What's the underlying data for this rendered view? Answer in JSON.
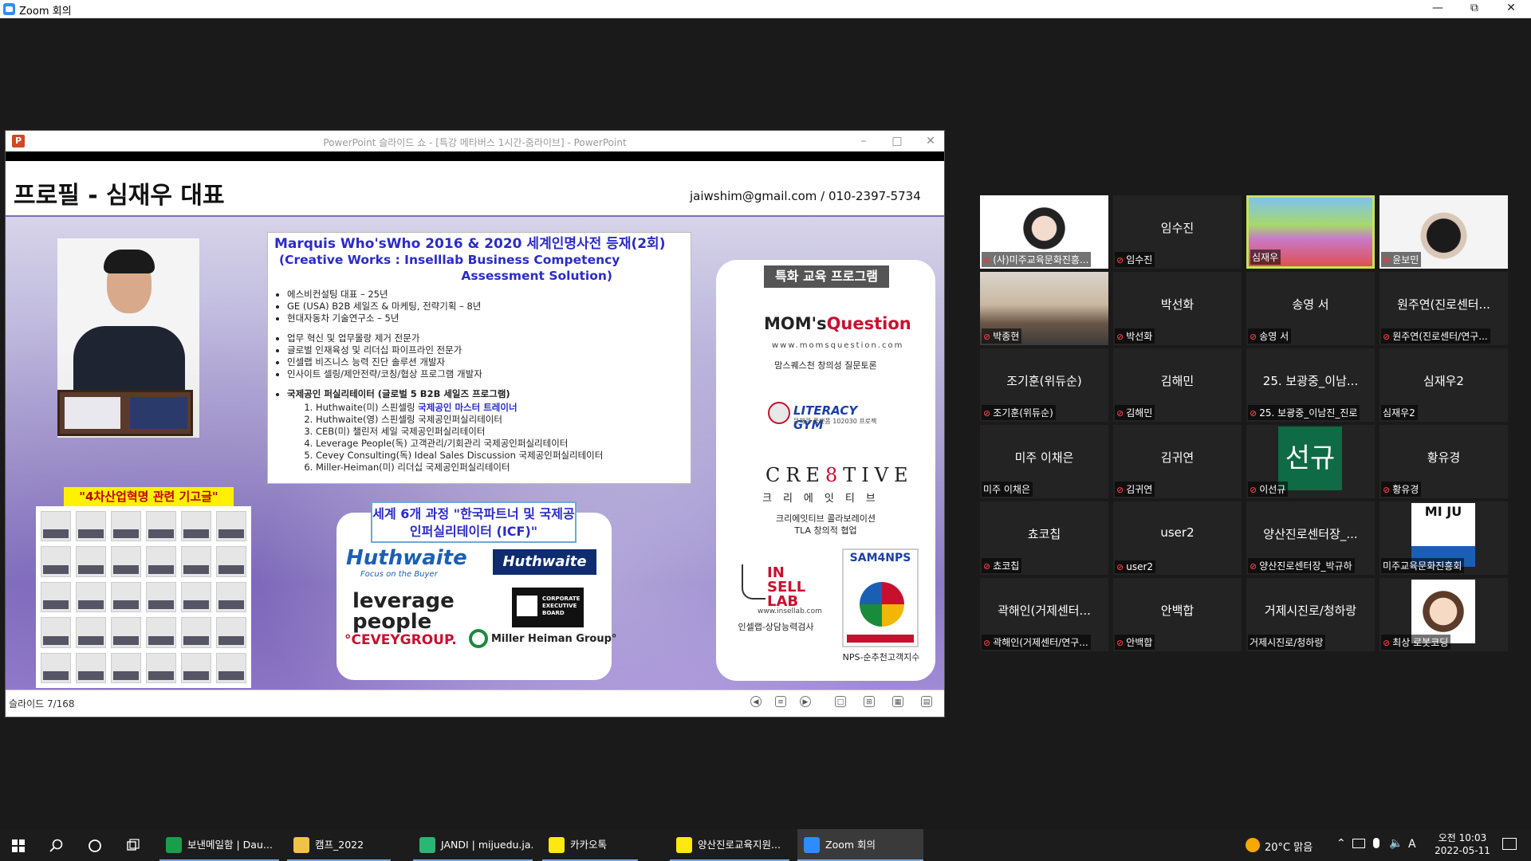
{
  "zoom_window": {
    "title": "Zoom 회의"
  },
  "ppt_window": {
    "title": "PowerPoint 슬라이드 쇼 - [특강 메타버스 1시간-줌라이브] - PowerPoint",
    "status": "슬라이드 7/168"
  },
  "slide": {
    "title": "프로필 - 심재우 대표",
    "contact": "jaiwshim@gmail.com  /  010-2397-5734",
    "main_heading_1": "Marquis Who'sWho 2016 & 2020 세계인명사전 등재(2회)",
    "main_heading_2": "(Creative Works : Inselllab Business Competency",
    "main_heading_3": "Assessment Solution)",
    "career": [
      "에스비컨설팅 대표 – 25년",
      "GE (USA) B2B 세일즈 & 마케팅, 전략기획 – 8년",
      "현대자동차 기술연구소 – 5년"
    ],
    "expertise": [
      "업무 혁신 및 업무몰랑 제거 전문가",
      "글로벌 인재육성 및 리더십 파이프라인 전문가",
      "인셀랩 비즈니스 능력 진단 솔루션 개발자",
      "인사이트 셀링/제안전략/코칭/협상 프로그램 개발자"
    ],
    "facilitator_heading": "국제공인 퍼실리테이터 (글로벌 5 B2B 세일즈 프로그램)",
    "facilitator_list": [
      {
        "text": "Huthwaite(미) 스핀셀링 ",
        "highlight": "국제공인 마스터 트레이너"
      },
      {
        "text": "Huthwaite(영) 스핀셀링 국제공인퍼실리테이터",
        "highlight": ""
      },
      {
        "text": "CEB(미) 챌린저 세일 국제공인퍼실리테이터",
        "highlight": ""
      },
      {
        "text": "Leverage People(독) 고객관리/기회관리 국제공인퍼실리테이터",
        "highlight": ""
      },
      {
        "text": "Cevey Consulting(독) Ideal Sales Discussion 국제공인퍼실리테이터",
        "highlight": ""
      },
      {
        "text": "Miller-Heiman(미) 리더십 국제공인퍼실리테이터",
        "highlight": ""
      }
    ],
    "article_banner": "\"4차산업혁명 관련 기고글\"",
    "icf_title": "세계 6개 과정 \"한국파트너 및 국제공인퍼실리테이터 (ICF)\"",
    "partner_logos": {
      "huthwaite1": "Huthwaite",
      "huthwaite1_tag": "Focus on the Buyer",
      "huthwaite2": "Huthwaite",
      "leverage": "leverage people",
      "ceb": "CORPORATE EXECUTIVE BOARD",
      "cevey": "°CEVEYGROUP.",
      "miller": "Miller Heiman Group°"
    },
    "program_title": "특화 교육 프로그램",
    "programs": {
      "moms_logo_a": "MOM's",
      "moms_logo_b": "Question",
      "moms_url": "www.momsquestion.com",
      "moms_label": "맘스퀘스천 창의성 질문토론",
      "literacy_logo": "LITERACY GYM",
      "literacy_sub": "문해력 플랫폼 102030 프로젝",
      "cre_logo_a": "CRE",
      "cre_logo_b": "8",
      "cre_logo_c": "TIVE",
      "cre_kr": "크리에잇티브",
      "cre_label_1": "크리에잇티브 콜라보레이션",
      "cre_label_2": "TLA 창의적 협업",
      "insell_logo": "IN SELL LAB",
      "insell_url": "www.insellab.com",
      "insell_label": "인셀랩-상담능력검사",
      "sam_logo": "SAM4NPS",
      "sam_label": "NPS-순추천고객지수"
    }
  },
  "participants": [
    {
      "name": "",
      "label": "(사)미주교육문화진흥...",
      "muted": true,
      "video": "girl-mask"
    },
    {
      "name": "임수진",
      "label": "임수진",
      "muted": true,
      "video": ""
    },
    {
      "name": "",
      "label": "심재우",
      "muted": false,
      "video": "speaker",
      "active": true
    },
    {
      "name": "",
      "label": "윤보민",
      "muted": true,
      "video": "boy-mask"
    },
    {
      "name": "",
      "label": "박종현",
      "muted": true,
      "video": "room"
    },
    {
      "name": "박선화",
      "label": "박선화",
      "muted": true,
      "video": ""
    },
    {
      "name": "송영 서",
      "label": "송영 서",
      "muted": true,
      "video": ""
    },
    {
      "name": "원주연(진로센터...",
      "label": "원주연(진로센터/연구...",
      "muted": true,
      "video": ""
    },
    {
      "name": "조기훈(위듀순)",
      "label": "조기훈(위듀순)",
      "muted": true,
      "video": ""
    },
    {
      "name": "김해민",
      "label": "김해민",
      "muted": true,
      "video": ""
    },
    {
      "name": "25. 보광중_이남...",
      "label": "25. 보광중_이남진_진로",
      "muted": true,
      "video": ""
    },
    {
      "name": "심재우2",
      "label": "심재우2",
      "muted": false,
      "video": ""
    },
    {
      "name": "미주 이채은",
      "label": "미주 이채은",
      "muted": false,
      "video": ""
    },
    {
      "name": "김귀연",
      "label": "김귀연",
      "muted": true,
      "video": ""
    },
    {
      "name": "",
      "label": "이선규",
      "muted": true,
      "video": "seongyu",
      "avatar_text": "선규"
    },
    {
      "name": "황유경",
      "label": "황유경",
      "muted": true,
      "video": ""
    },
    {
      "name": "쵸코칩",
      "label": "쵸코칩",
      "muted": true,
      "video": ""
    },
    {
      "name": "user2",
      "label": "user2",
      "muted": true,
      "video": ""
    },
    {
      "name": "양산진로센터장_...",
      "label": "양산진로센터장_박규하",
      "muted": true,
      "video": ""
    },
    {
      "name": "",
      "label": "미주교육문화진흥회",
      "muted": false,
      "video": "miju",
      "avatar_text": "MI JU"
    },
    {
      "name": "곽해인(거제센터...",
      "label": "곽해인(거제센터/연구...",
      "muted": true,
      "video": ""
    },
    {
      "name": "안백합",
      "label": "안백합",
      "muted": true,
      "video": ""
    },
    {
      "name": "거제시진로/청하랑",
      "label": "거제시진로/청하랑",
      "muted": false,
      "video": ""
    },
    {
      "name": "",
      "label": "최상 로봇코딩",
      "muted": true,
      "video": "cartoon"
    }
  ],
  "taskbar": {
    "apps": [
      {
        "label": "보낸메일함 | Dau...",
        "color": "#1a9e4b"
      },
      {
        "label": "캠프_2022",
        "color": "#f0c24a"
      },
      {
        "label": "JANDI | mijuedu.ja...",
        "color": "#2bb673"
      },
      {
        "label": "카카오톡",
        "color": "#ffe812"
      },
      {
        "label": "양산진로교육지원...",
        "color": "#ffe812"
      },
      {
        "label": "Zoom 회의",
        "color": "#2d8cff"
      }
    ],
    "weather": "20°C 맑음",
    "ime": "A",
    "time": "오전 10:03",
    "date": "2022-05-11"
  },
  "colors": {
    "zoom_active_border": "#c8e35a",
    "slide_heading_blue": "#2b2bc8",
    "mute_red": "#e23b3b"
  }
}
